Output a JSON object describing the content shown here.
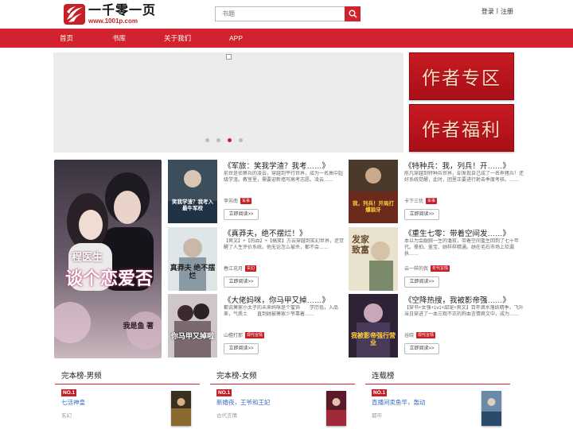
{
  "header": {
    "logo_title": "一千零一页",
    "logo_url": "www.1001p.com",
    "search_placeholder": "书题",
    "login": "登录",
    "separator": "|",
    "register": "注册"
  },
  "nav": [
    "首页",
    "书库",
    "关于我们",
    "APP"
  ],
  "banner": {
    "slide_count": 4,
    "active_slide": 3
  },
  "promos": [
    "作者专区",
    "作者福利"
  ],
  "feature": {
    "cover_title_top": "程医生",
    "cover_title_main": "谈个恋爱否",
    "cover_author": "我是鱼 著"
  },
  "read_label": "立即阅读>>",
  "books": [
    {
      "title": "《军旅：笑我学渣？我考……》",
      "desc": "前世是侦察兵的凌云，穿越到平行世界，成为一名高中超级学渣。教室里，需要迎新墙写高考志愿。凌云……",
      "author": "李苏南",
      "tag": "军事",
      "cover_text": "笑我学渣？我考入最牛军校"
    },
    {
      "title": "《特种兵：我，列兵！开……》",
      "desc": "陈凡穿越到特种兵世界，却发现自己成了一名养猪兵！还好系统觉醒，此时，团里正要进行射击季度考核。……",
      "author": "卡下三忧",
      "tag": "军事",
      "cover_text": "我，列兵！开局打爆狼牙"
    },
    {
      "title": "《真莽夫，绝不摆烂！》",
      "desc": "【爽文】+【热血】+【搞笑】方云穿越到玄幻世界，还觉醒了人生评价系统。他无论怎么被杀，都不会……",
      "author": "春江花月",
      "tag": "玄幻",
      "cover_text": "真莽夫 绝不摆烂"
    },
    {
      "title": "《重生七零：带着空间发……》",
      "desc": "本以为会腿腕一生的潘玫，带着空间重生回到了七十年代。豪拍、鉴宝、她样样精通。她在毛石市场上捡漏执……",
      "author": "云一样的我",
      "tag": "年代言情",
      "cover_text": "发家致富"
    },
    {
      "title": "《大佬妈咪，你马甲又掉……》",
      "desc": "都说萧家小太子的未来妈咪是个蜜饰　　学历低，入品差，气质土　　直到她被萧家少爷靠着……",
      "author": "山檀打那",
      "tag": "现代言情",
      "cover_text": "你马甲又掉啦"
    },
    {
      "title": "《空降热搜，我被影帝强……》",
      "desc": "【穿书+女强+1v1+甜宠+爽文】百年滴水落妖精季，飞升当日穿进了一本三观不正的狗血言情爽文中，成为……",
      "author": "谷晓",
      "tag": "现代言情",
      "cover_text": "我被影帝强行营业"
    }
  ],
  "rankings": [
    {
      "title": "完本榜-男频",
      "no": "NO.1",
      "book": "七活神皇",
      "cat": "玄幻"
    },
    {
      "title": "完本榜-女频",
      "no": "NO.1",
      "book": "新婚夜，王爷和王妃",
      "cat": "古代言情"
    },
    {
      "title": "连载榜",
      "no": "NO.1",
      "book": "直播间卖鱼竿，轰动",
      "cat": "都市"
    }
  ],
  "colors": {
    "brand_red": "#d2222d"
  }
}
